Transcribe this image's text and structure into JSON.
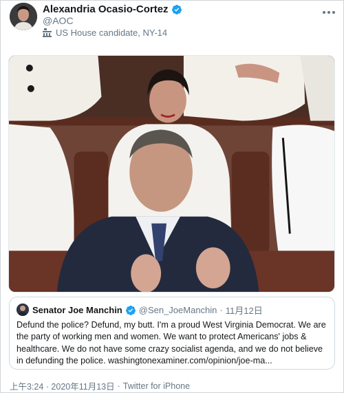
{
  "tweet": {
    "author_name": "Alexandria Ocasio-Cortez",
    "author_handle": "@AOC",
    "author_label": "US House candidate, NY-14",
    "verified_icon": "verified-badge-icon",
    "label_icon": "government-building-icon",
    "timestamp": "上午3:24 · 2020年11月13日",
    "separator": "·",
    "source": "Twitter for iPhone"
  },
  "quoted_tweet": {
    "author_name": "Senator Joe Manchin",
    "author_handle": "@Sen_JoeManchin",
    "separator": "·",
    "date": "11月12日",
    "text": "Defund the police? Defund, my butt. I'm a proud West Virginia Democrat. We are the party of working men and women. We want to protect Americans' jobs & healthcare. We do not have some crazy socialist agenda, and we do not believe in defunding the police. washingtonexaminer.com/opinion/joe-ma..."
  },
  "colors": {
    "verified": "#1da1f2",
    "text_primary": "#14171a",
    "text_secondary": "#657786",
    "border": "#cfd9de"
  }
}
